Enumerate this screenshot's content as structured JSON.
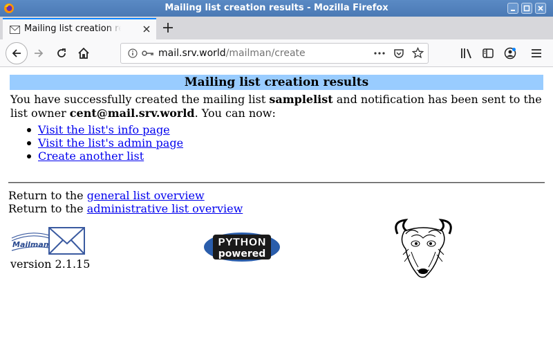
{
  "window": {
    "title": "Mailing list creation results - Mozilla Firefox",
    "controls": [
      "minimize",
      "maximize",
      "close"
    ]
  },
  "tab": {
    "label": "Mailing list creation results",
    "icon": "mail-icon"
  },
  "navbar": {
    "url_host": "mail.srv.world",
    "url_path": "/mailman/create"
  },
  "page": {
    "heading": "Mailing list creation results",
    "intro_before": "You have successfully created the mailing list ",
    "list_name": "samplelist",
    "intro_middle": " and notification has been sent to the list owner ",
    "owner": "cent@mail.srv.world",
    "intro_after": ". You can now:",
    "links": [
      {
        "label": "Visit the list's info page"
      },
      {
        "label": "Visit the list's admin page"
      },
      {
        "label": "Create another list"
      }
    ],
    "return_prefix": "Return to the ",
    "general_overview": "general list overview",
    "admin_overview": "administrative list overview",
    "version": "version 2.1.15",
    "mailman_logo_text": "Mailman",
    "python_logo_line1": "PYTHON",
    "python_logo_line2": "powered"
  }
}
